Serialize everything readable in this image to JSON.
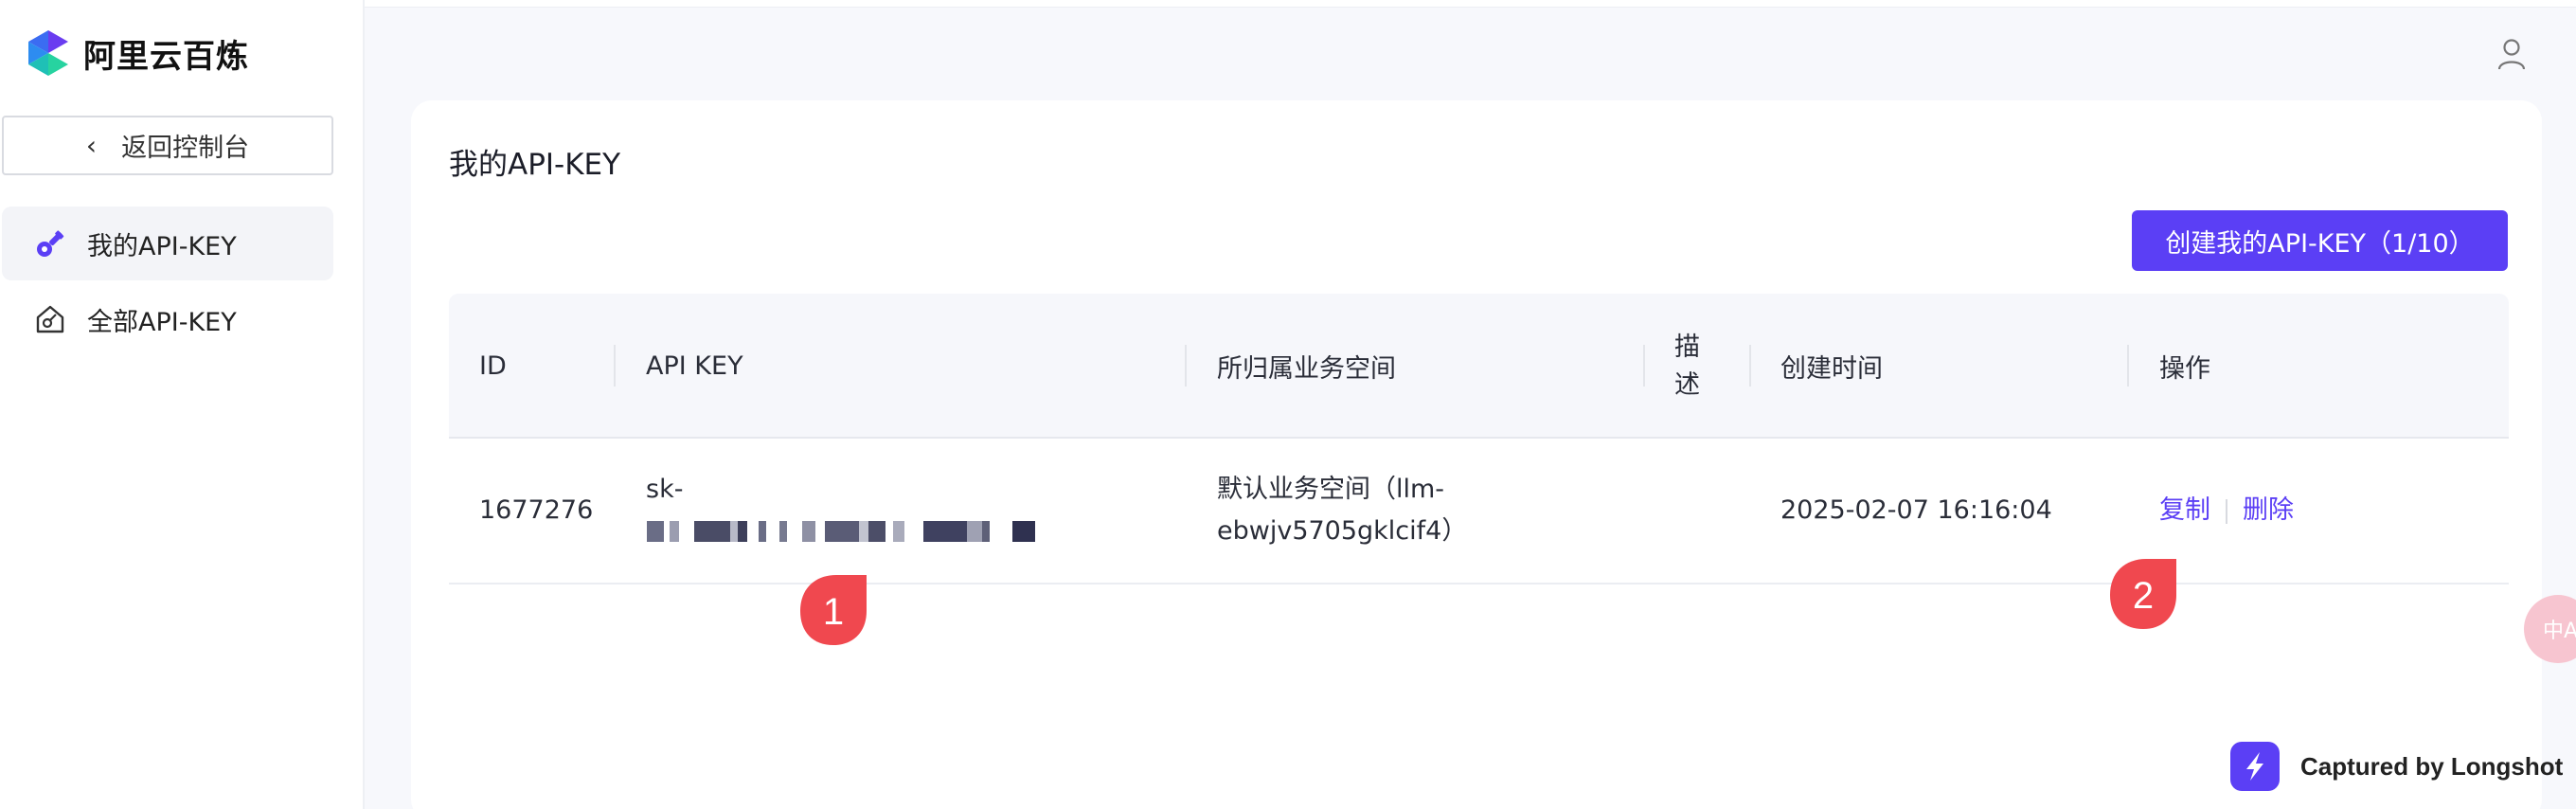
{
  "brand": {
    "name": "阿里云百炼"
  },
  "sidebar": {
    "back_label": "返回控制台",
    "items": [
      {
        "label": "我的API-KEY",
        "active": true
      },
      {
        "label": "全部API-KEY",
        "active": false
      }
    ]
  },
  "main": {
    "title": "我的API-KEY",
    "create_button": "创建我的API-KEY（1/10）",
    "table": {
      "headers": [
        "ID",
        "API KEY",
        "所归属业务空间",
        "描\n述",
        "创建时间",
        "操作"
      ],
      "rows": [
        {
          "id": "1677276",
          "api_key_prefix": "sk-",
          "workspace_line1": "默认业务空间（llm-",
          "workspace_line2": "ebwjv5705gklcif4）",
          "description": "",
          "created": "2025-02-07 16:16:04",
          "actions": [
            "复制",
            "删除"
          ]
        }
      ]
    }
  },
  "markers": [
    "1",
    "2"
  ],
  "float_bubble": "中A",
  "watermark": "Captured by Longshot",
  "colors": {
    "accent": "#5b3ff5",
    "marker": "#f0484f"
  }
}
